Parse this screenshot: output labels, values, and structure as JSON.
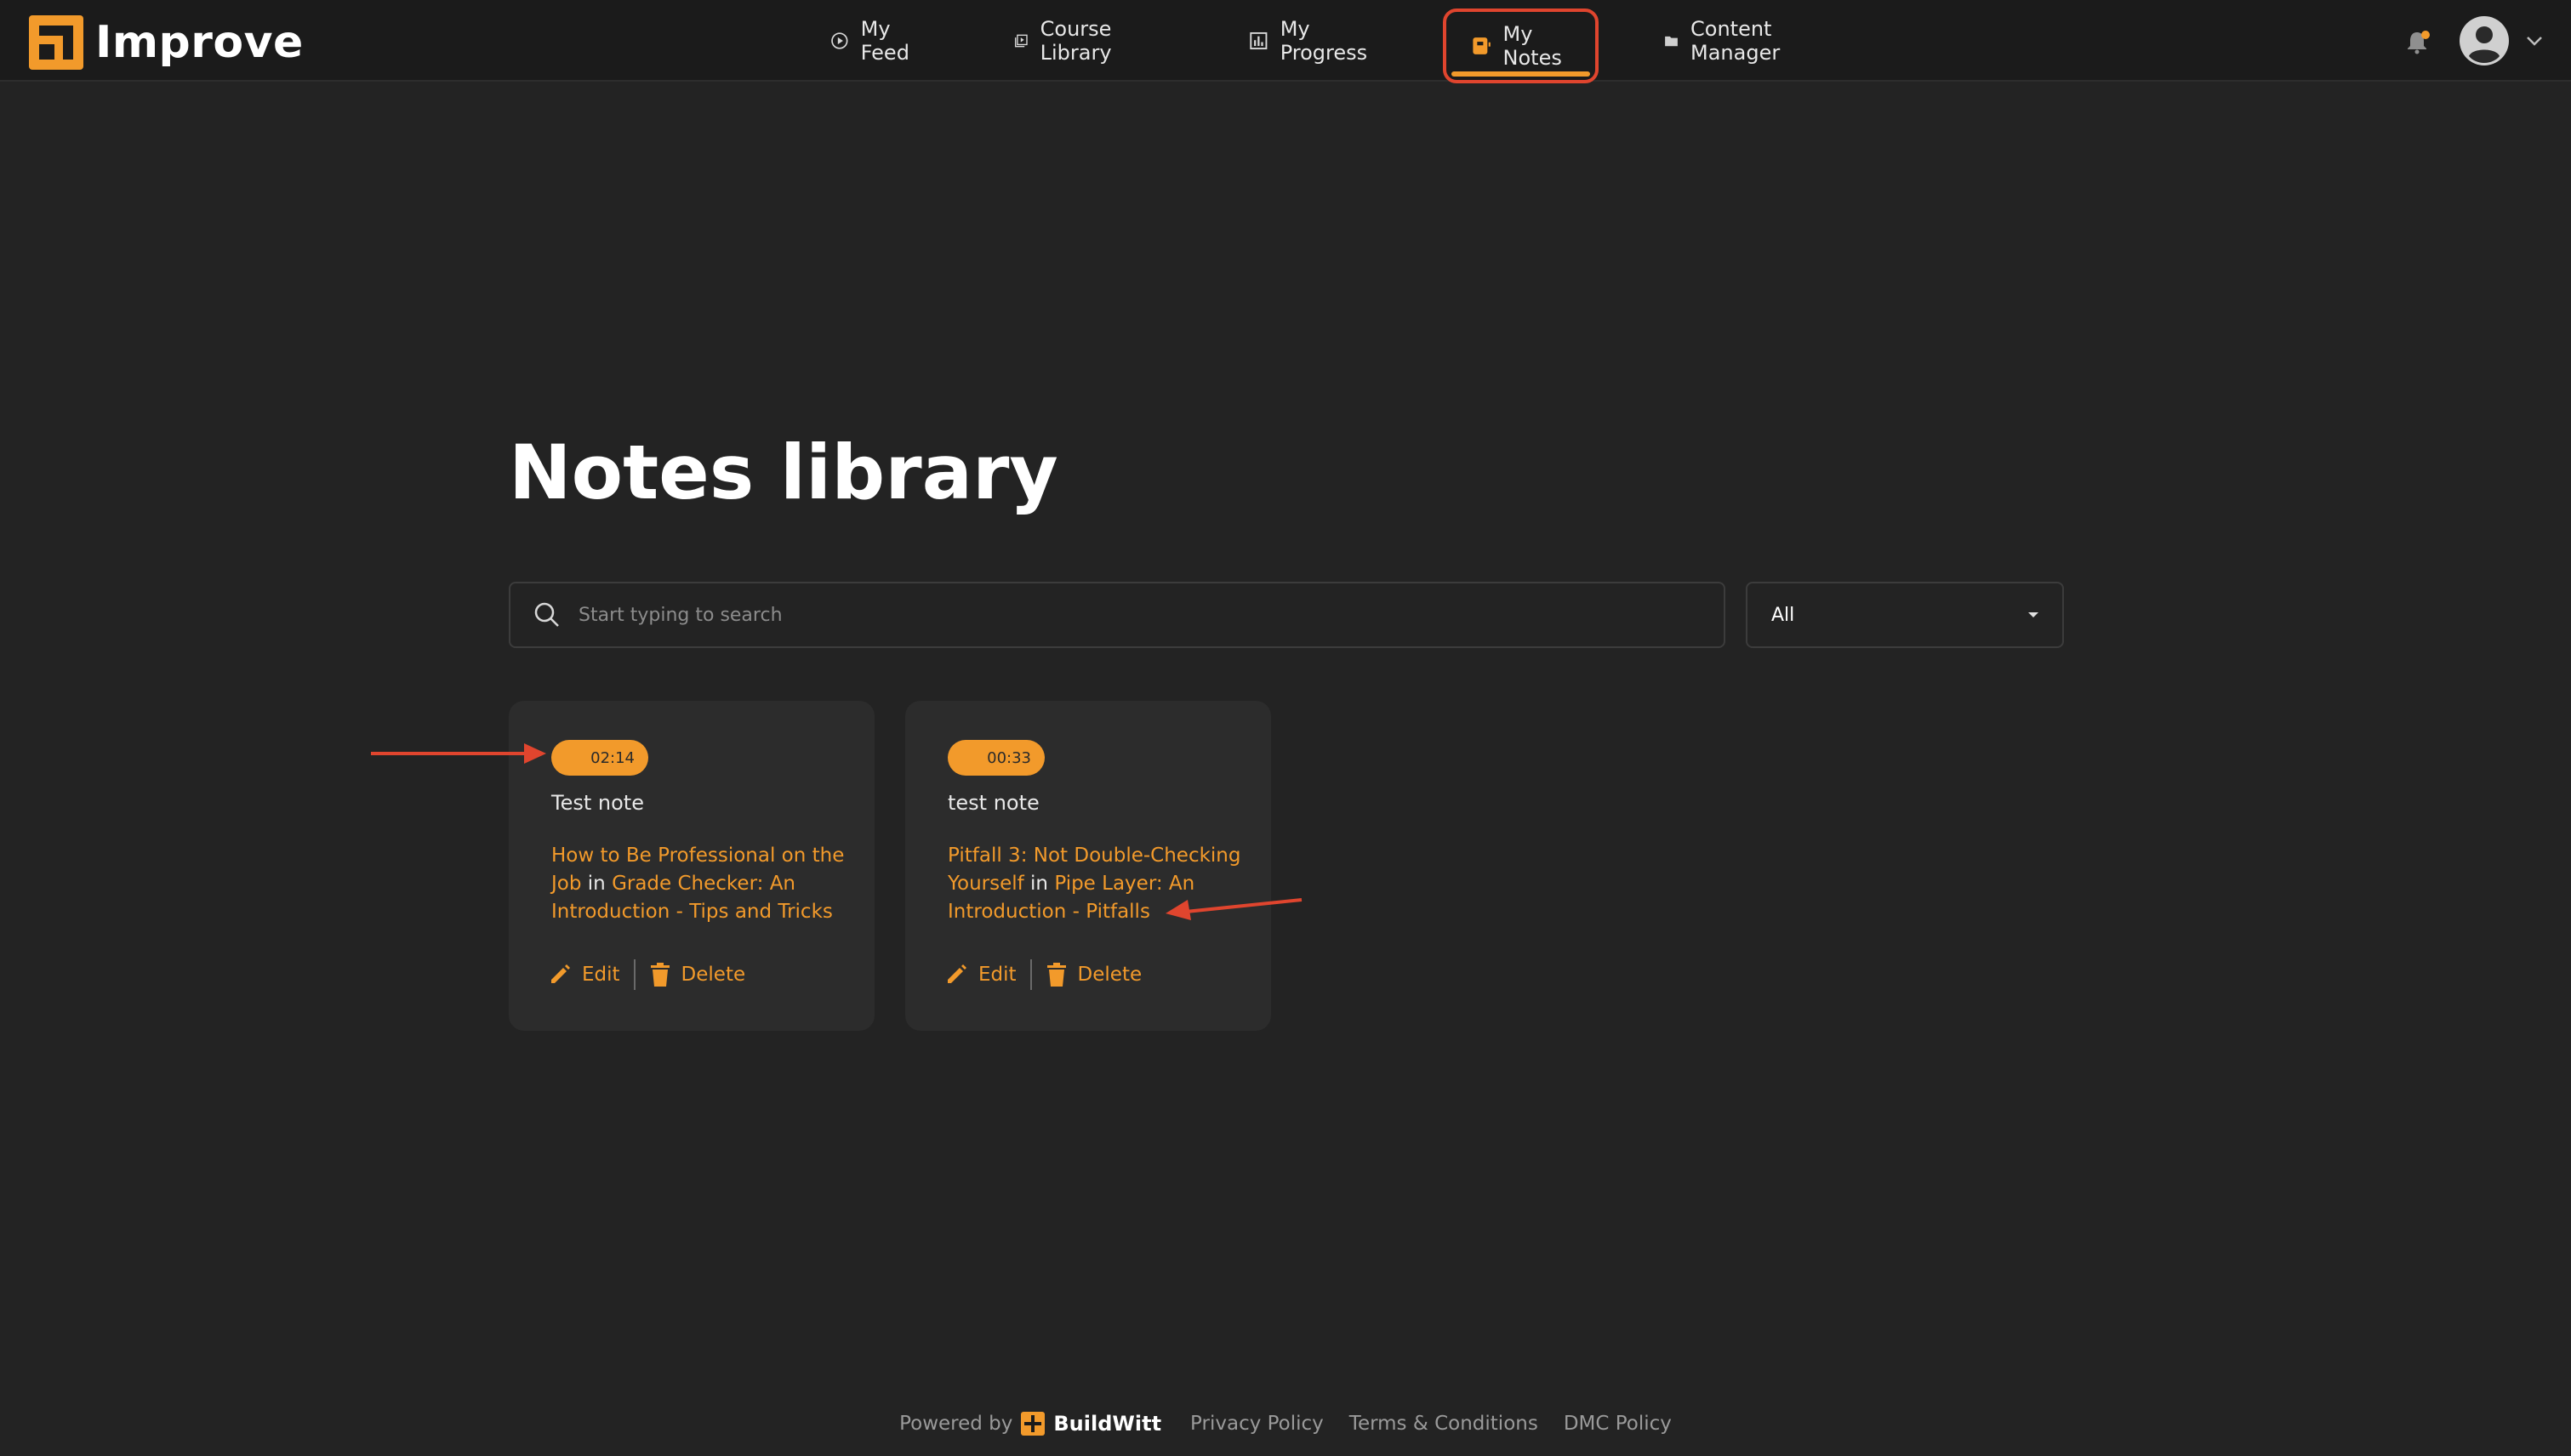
{
  "app": {
    "name": "Improve"
  },
  "nav": {
    "items": [
      {
        "label": "My Feed",
        "icon": "play-circle-icon"
      },
      {
        "label": "Course Library",
        "icon": "video-library-icon"
      },
      {
        "label": "My Progress",
        "icon": "bar-chart-icon"
      },
      {
        "label": "My Notes",
        "icon": "notes-icon",
        "active": true
      },
      {
        "label": "Content Manager",
        "icon": "folder-icon"
      }
    ]
  },
  "page": {
    "title": "Notes library"
  },
  "search": {
    "placeholder": "Start typing to search",
    "value": ""
  },
  "filter": {
    "selected": "All"
  },
  "notes": [
    {
      "timestamp": "02:14",
      "title": "Test note",
      "lesson": "How to Be Professional on the Job",
      "in_label": "in",
      "course": "Grade Checker: An Introduction - Tips and Tricks",
      "edit_label": "Edit",
      "delete_label": "Delete"
    },
    {
      "timestamp": "00:33",
      "title": "test note",
      "lesson": "Pitfall 3: Not Double-Checking Yourself",
      "in_label": "in",
      "course": "Pipe Layer: An Introduction - Pitfalls",
      "edit_label": "Edit",
      "delete_label": "Delete"
    }
  ],
  "footer": {
    "powered_by": "Powered by",
    "brand": "BuildWitt",
    "links": [
      "Privacy Policy",
      "Terms & Conditions",
      "DMC Policy"
    ]
  },
  "colors": {
    "accent": "#f29a2b",
    "background": "#232323",
    "topbar": "#1b1b1b",
    "card": "#2c2c2c",
    "annotation": "#e0452e"
  }
}
